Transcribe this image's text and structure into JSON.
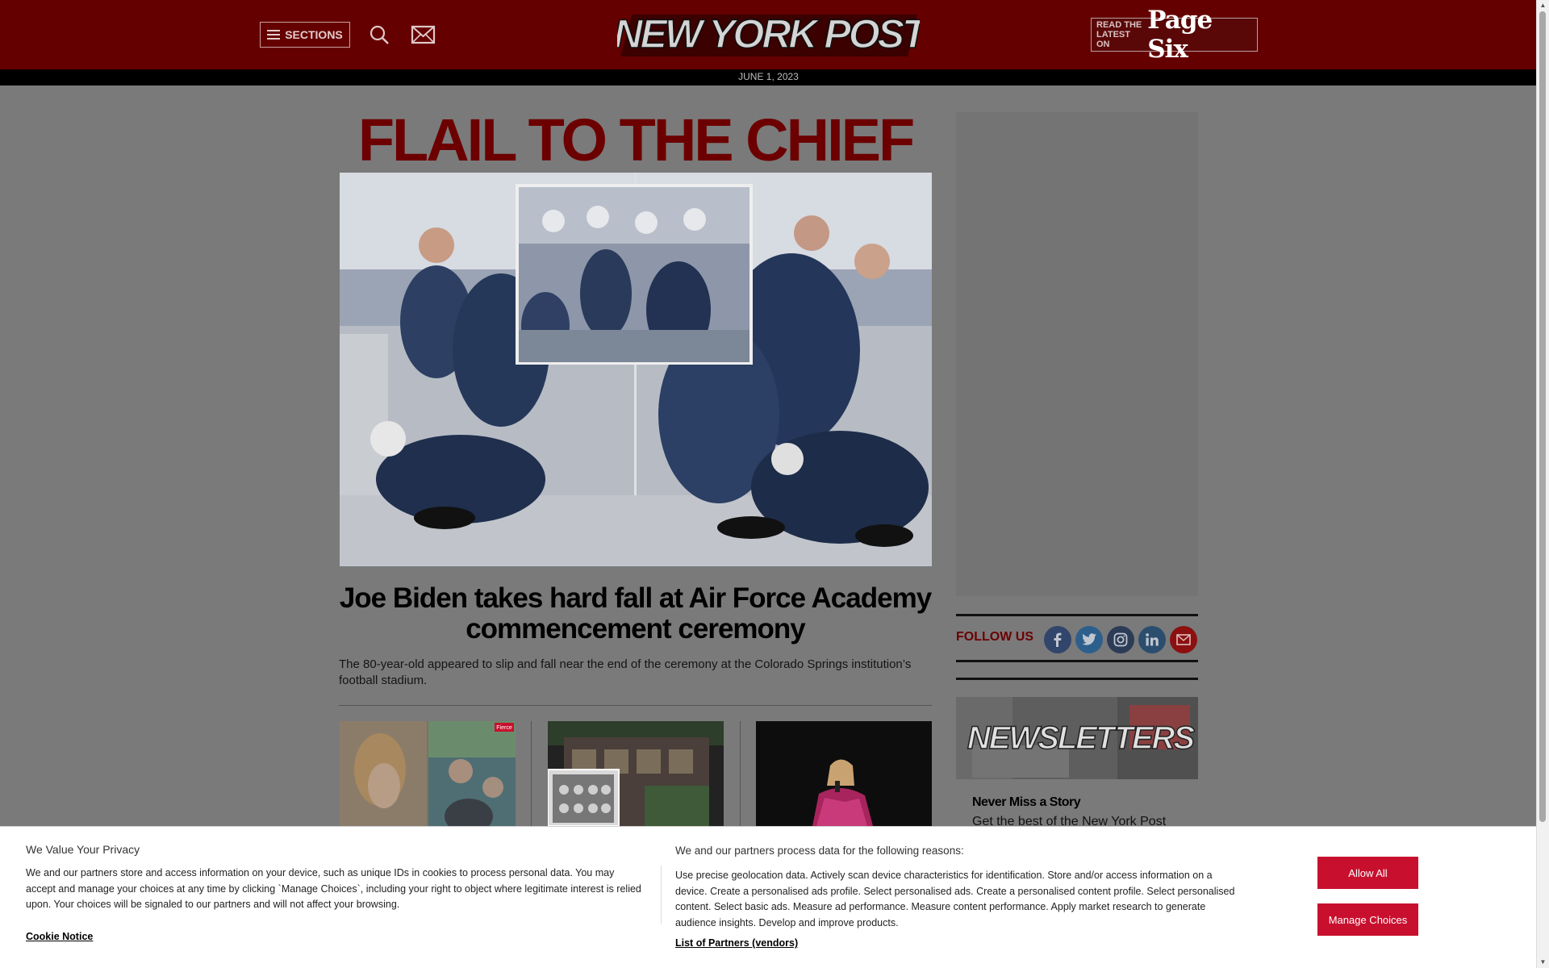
{
  "header": {
    "sections_label": "SECTIONS",
    "logo_text": "NEW YORK POST",
    "pagesix_small_line1": "READ THE",
    "pagesix_small_line2": "LATEST ON",
    "pagesix_brand": "Page Six",
    "date": "JUNE 1, 2023"
  },
  "main": {
    "banner_headline": "FLAIL TO THE CHIEF",
    "article_title": "Joe Biden takes hard fall at Air Force Academy commencement ceremony",
    "article_dek": "The 80-year-old appeared to slip and fall near the end of the ceremony at the Colorado Springs institution’s football stadium.",
    "thumb_badge": "Fierce"
  },
  "sidebar": {
    "follow_label": "FOLLOW US",
    "social": [
      "facebook",
      "twitter",
      "instagram",
      "linkedin",
      "email"
    ],
    "newsletters_banner": "NEWSLETTERS",
    "newsletter_title": "Never Miss a Story",
    "newsletter_sub": "Get the best of the New York Post"
  },
  "cookie": {
    "title": "We Value Your Privacy",
    "text": "We and our partners store and access information on your device, such as unique IDs in cookies to process personal data. You may accept and manage your choices at any time by clicking `Manage Choices`, including your right to object where legitimate interest is relied upon. Your choices will be signaled to our partners and will not affect your browsing.",
    "notice_link": "Cookie Notice",
    "reasons_title": "We and our partners process data for the following reasons:",
    "reasons_text": "Use precise geolocation data. Actively scan device characteristics for identification. Store and/or access information on a device. Create a personalised ads profile. Select personalised ads. Create a personalised content profile. Select personalised content. Select basic ads. Measure ad performance. Measure content performance. Apply market research to generate audience insights. Develop and improve products.",
    "partners_link": "List of Partners (vendors)",
    "allow_all": "Allow All",
    "manage_choices": "Manage Choices"
  },
  "colors": {
    "header_bg": "#650000",
    "headline_red": "#6c0000",
    "button_red": "#c8102e"
  }
}
